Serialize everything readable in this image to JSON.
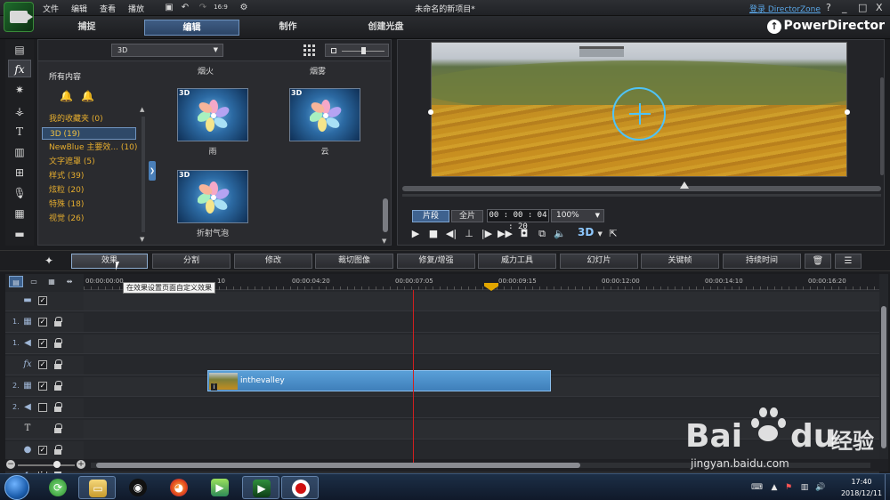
{
  "menu": {
    "file": "文件",
    "edit": "编辑",
    "view": "查看",
    "play": "播放"
  },
  "window": {
    "title": "未命名的新项目*",
    "login": "登录 DirectorZone",
    "help": "?",
    "minimize": "_",
    "maximize": "□",
    "close": "X"
  },
  "modes": {
    "capture": "捕捉",
    "edit": "编辑",
    "produce": "制作",
    "disc": "创建光盘"
  },
  "brand": "PowerDirector",
  "rail": [
    "media-room",
    "fx-room",
    "pip-room",
    "particle-room",
    "title-room",
    "transition-room",
    "audio-mixing-room",
    "voice-over-room",
    "chapter-room",
    "subtitle-room"
  ],
  "library": {
    "category_select": "3D",
    "all_content": "所有内容",
    "categories": [
      {
        "label": "我的收藏夹  (0)"
      },
      {
        "label": "3D  (19)"
      },
      {
        "label": "NewBlue 主要效...  (10)"
      },
      {
        "label": "文字遮罩  (5)"
      },
      {
        "label": "样式  (39)"
      },
      {
        "label": "炫粒  (20)"
      },
      {
        "label": "特殊  (18)"
      },
      {
        "label": "视觉  (26)"
      }
    ],
    "selected_category": 1,
    "row_top_labels": [
      "烟火",
      "烟雾"
    ],
    "effects": [
      {
        "label": "雨",
        "badge": "3D"
      },
      {
        "label": "云",
        "badge": "3D"
      },
      {
        "label": "折射气泡",
        "badge": "3D"
      }
    ]
  },
  "preview": {
    "mode_clip": "片段",
    "mode_movie": "全片",
    "timecode": "00 : 00 : 04 : 20",
    "zoom": "100%",
    "stereo": "3D",
    "seek_fraction": 0.59
  },
  "edit_toolbar": {
    "effect": "效果",
    "split": "分割",
    "modify": "修改",
    "crop": "裁切图像",
    "fix": "修复/增强",
    "power_tools": "威力工具",
    "slideshow": "幻灯片",
    "keyframe": "关键帧",
    "duration": "持续时间"
  },
  "timeline": {
    "tooltip": "在效果设置页面自定义效果",
    "ruler_labels": [
      "00:00:00:00",
      "00:00:04:20",
      "00:00:07:05",
      "00:00:09:15",
      "00:00:12:00",
      "00:00:14:10",
      "00:00:16:20"
    ],
    "ruler_fragment": "10",
    "tracks": [
      {
        "num": "",
        "icon": "master-video-track-icon",
        "glyph": "▬",
        "checked": true,
        "lock": false
      },
      {
        "num": "1.",
        "icon": "video-track-icon",
        "glyph": "▦",
        "checked": true,
        "lock": true
      },
      {
        "num": "1.",
        "icon": "audio-track-icon",
        "glyph": "◀",
        "checked": true,
        "lock": true
      },
      {
        "num": "",
        "icon": "fx-track-icon",
        "glyph": "fx",
        "checked": true,
        "lock": true
      },
      {
        "num": "2.",
        "icon": "video-track-icon",
        "glyph": "▦",
        "checked": true,
        "lock": true
      },
      {
        "num": "2.",
        "icon": "audio-track-icon",
        "glyph": "◀",
        "checked": false,
        "lock": true
      },
      {
        "num": "",
        "icon": "title-track-icon",
        "glyph": "T",
        "checked": null,
        "lock": true
      },
      {
        "num": "",
        "icon": "voice-track-icon",
        "glyph": "●",
        "checked": true,
        "lock": true
      },
      {
        "num": "",
        "icon": "music-track-icon",
        "glyph": "♪",
        "checked": true,
        "lock": true
      }
    ],
    "clip": {
      "name": "inthevalley",
      "info": "i"
    }
  },
  "taskbar": {
    "time": "17:40",
    "date": "2018/12/11",
    "apps": [
      "file-explorer",
      "qq",
      "firefox",
      "camtasia",
      "powerdirector",
      "screen-recorder"
    ]
  },
  "watermark": {
    "brand": "Bai",
    "brand2": "du",
    "suffix": "经验",
    "url": "jingyan.baidu.com"
  }
}
